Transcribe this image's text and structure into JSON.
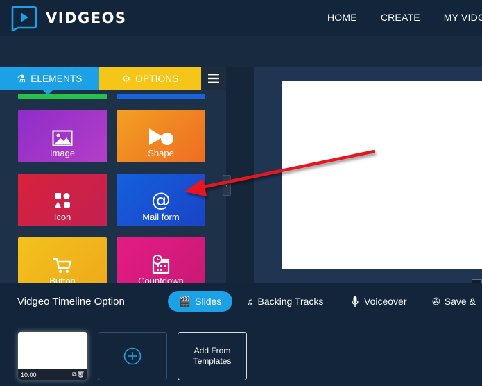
{
  "header": {
    "brand": "VIDGEOS",
    "nav": [
      "HOME",
      "CREATE",
      "MY VIDGE"
    ]
  },
  "panel": {
    "tabs": {
      "elements": "ELEMENTS",
      "options": "OPTIONS"
    },
    "tiles": [
      {
        "label": "Image",
        "icon": "image-icon"
      },
      {
        "label": "Shape",
        "icon": "shape-icon"
      },
      {
        "label": "Icon",
        "icon": "icon-set-icon"
      },
      {
        "label": "Mail form",
        "icon": "at-sign-icon"
      },
      {
        "label": "Button",
        "icon": "cart-icon"
      },
      {
        "label": "Countdown",
        "icon": "calendar-clock-icon"
      }
    ]
  },
  "timeline": {
    "title": "Vidgeo Timeline Option",
    "buttons": {
      "slides": "Slides",
      "backing": "Backing Tracks",
      "voiceover": "Voiceover",
      "save": "Save &"
    }
  },
  "slides": {
    "items": [
      {
        "time": "10.00"
      }
    ],
    "add_template": "Add From Templates"
  },
  "colors": {
    "accent_blue": "#1da1e6",
    "options_yellow": "#f5c518",
    "annotation_red": "#e8161b"
  }
}
